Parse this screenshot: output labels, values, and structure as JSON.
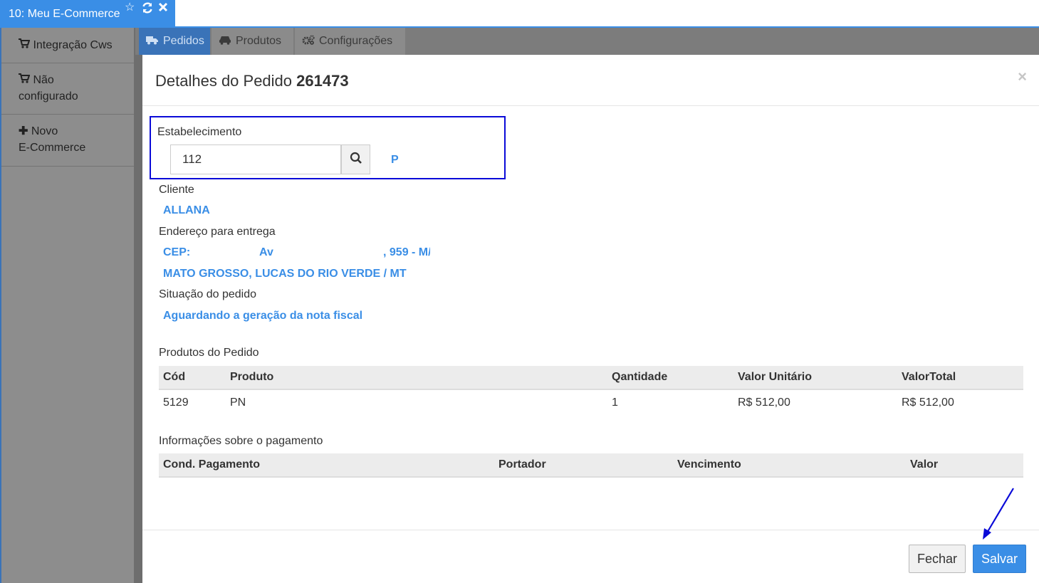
{
  "window_tab": {
    "title": "10: Meu E-Commerce"
  },
  "sidebar": {
    "items": [
      {
        "label": "Integração Cws"
      },
      {
        "label_line1": "Não",
        "label_line2": "configurado"
      },
      {
        "label_line1": "Novo",
        "label_line2": "E-Commerce"
      }
    ]
  },
  "tabs": [
    {
      "label": "Pedidos",
      "icon": "truck-icon",
      "active": true
    },
    {
      "label": "Produtos",
      "icon": "car-icon",
      "active": false
    },
    {
      "label": "Configurações",
      "icon": "gears-icon",
      "active": false
    }
  ],
  "modal": {
    "title_prefix": "Detalhes do Pedido",
    "order_number": "261473",
    "close": "×",
    "establishment": {
      "label": "Estabelecimento",
      "value": "112",
      "name": "P"
    },
    "client": {
      "label": "Cliente",
      "value": "ALLANA"
    },
    "address": {
      "label": "Endereço para entrega",
      "cep": "CEP:",
      "street": "Av",
      "number": ", 959 - M/",
      "city_line": "MATO GROSSO, LUCAS DO RIO VERDE / MT"
    },
    "status": {
      "label": "Situação do pedido",
      "value": "Aguardando a geração da nota fiscal"
    },
    "products": {
      "label": "Produtos do Pedido",
      "columns": [
        "Cód",
        "Produto",
        "Qantidade",
        "Valor Unitário",
        "ValorTotal"
      ],
      "rows": [
        [
          "5129",
          "PN",
          "1",
          "R$ 512,00",
          "R$ 512,00"
        ]
      ]
    },
    "payment": {
      "label": "Informações sobre o pagamento",
      "columns": [
        "Cond. Pagamento",
        "Portador",
        "Vencimento",
        "Valor"
      ]
    },
    "buttons": {
      "close": "Fechar",
      "save": "Salvar"
    }
  },
  "colors": {
    "accent": "#3a8ee6",
    "highlight_box": "#0a0ad8",
    "sidebar": "#8d8d8d"
  }
}
